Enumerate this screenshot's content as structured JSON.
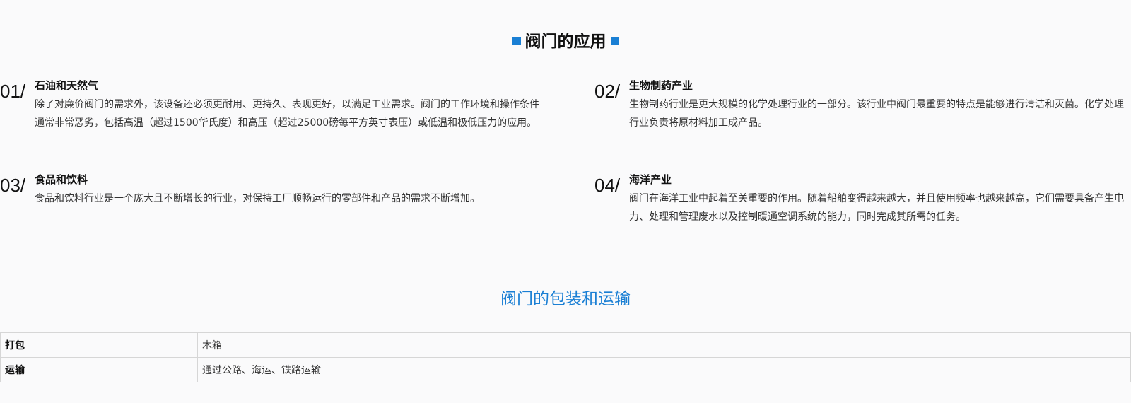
{
  "applications": {
    "title": "阀门的应用",
    "items": [
      {
        "number": "01/",
        "heading": "石油和天然气",
        "text": "除了对廉价阀门的需求外，该设备还必须更耐用、更持久、表现更好，以满足工业需求。阀门的工作环境和操作条件通常非常恶劣，包括高温（超过1500华氏度）和高压（超过25000磅每平方英寸表压）或低温和极低压力的应用。"
      },
      {
        "number": "02/",
        "heading": "生物制药产业",
        "text": "生物制药行业是更大规模的化学处理行业的一部分。该行业中阀门最重要的特点是能够进行清洁和灭菌。化学处理行业负责将原材料加工成产品。"
      },
      {
        "number": "03/",
        "heading": "食品和饮料",
        "text": "食品和饮料行业是一个庞大且不断增长的行业，对保持工厂顺畅运行的零部件和产品的需求不断增加。"
      },
      {
        "number": "04/",
        "heading": "海洋产业",
        "text": "阀门在海洋工业中起着至关重要的作用。随着船舶变得越来越大，并且使用频率也越来越高，它们需要具备产生电力、处理和管理废水以及控制暖通空调系统的能力，同时完成其所需的任务。"
      }
    ]
  },
  "packaging": {
    "title": "阀门的包装和运输",
    "rows": [
      {
        "label": "打包",
        "value": "木箱"
      },
      {
        "label": "运输",
        "value": "通过公路、海运、铁路运输"
      }
    ]
  },
  "colors": {
    "accent": "#1a7fd4"
  }
}
